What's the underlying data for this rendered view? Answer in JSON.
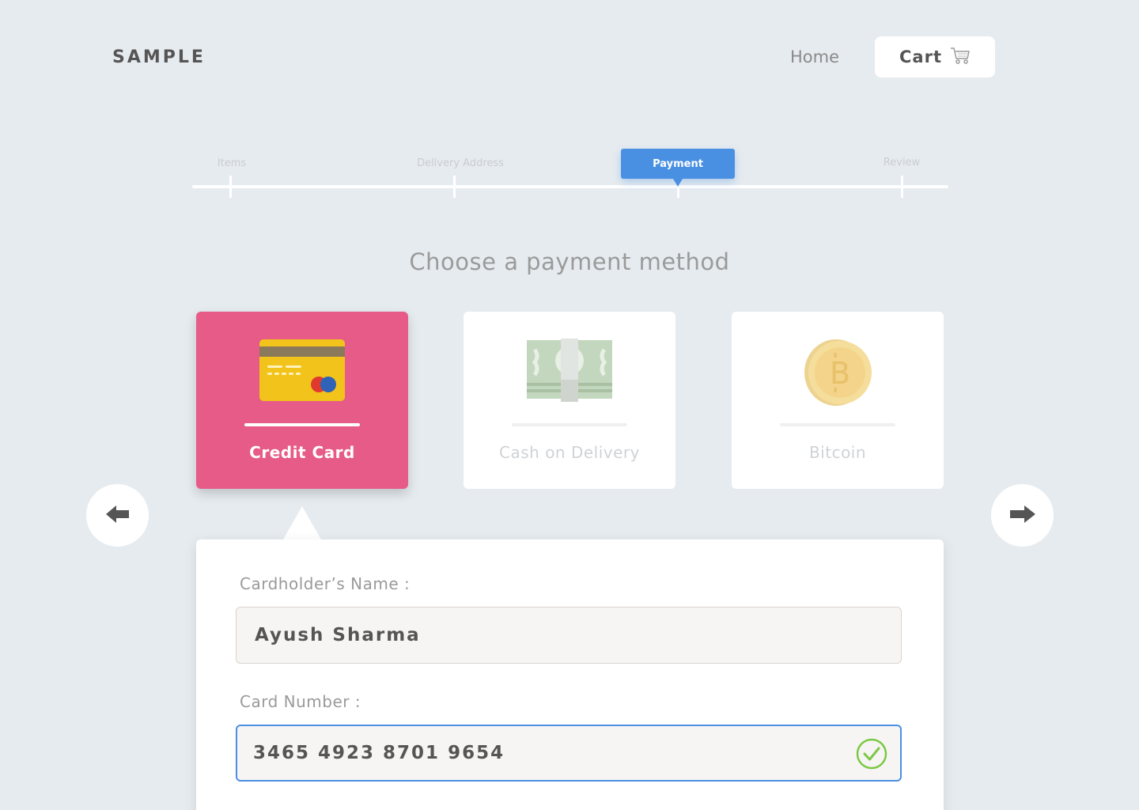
{
  "header": {
    "logo": "SAMPLE",
    "nav_home": "Home",
    "cart_label": "Cart",
    "cart_icon": "cart-icon"
  },
  "stepper": {
    "steps": [
      "Items",
      "Delivery Address",
      "Payment",
      "Review"
    ],
    "active_index": 2
  },
  "main": {
    "title": "Choose a payment method",
    "methods": [
      {
        "label": "Credit Card",
        "icon": "credit-card-icon",
        "selected": true
      },
      {
        "label": "Cash on Delivery",
        "icon": "cash-icon",
        "selected": false
      },
      {
        "label": "Bitcoin",
        "icon": "bitcoin-icon",
        "selected": false
      }
    ],
    "prev_icon": "arrow-left-icon",
    "next_icon": "arrow-right-icon"
  },
  "form": {
    "cardholder_label": "Cardholder’s Name :",
    "cardholder_value": "Ayush Sharma",
    "card_number_label": "Card Number :",
    "card_number_value": "3465 4923 8701 9654",
    "card_number_valid_icon": "check-circle-icon"
  },
  "colors": {
    "background": "#e6ebef",
    "accent_blue": "#4a90e2",
    "selected_pink": "#e65b87",
    "valid_green": "#7ac943"
  }
}
